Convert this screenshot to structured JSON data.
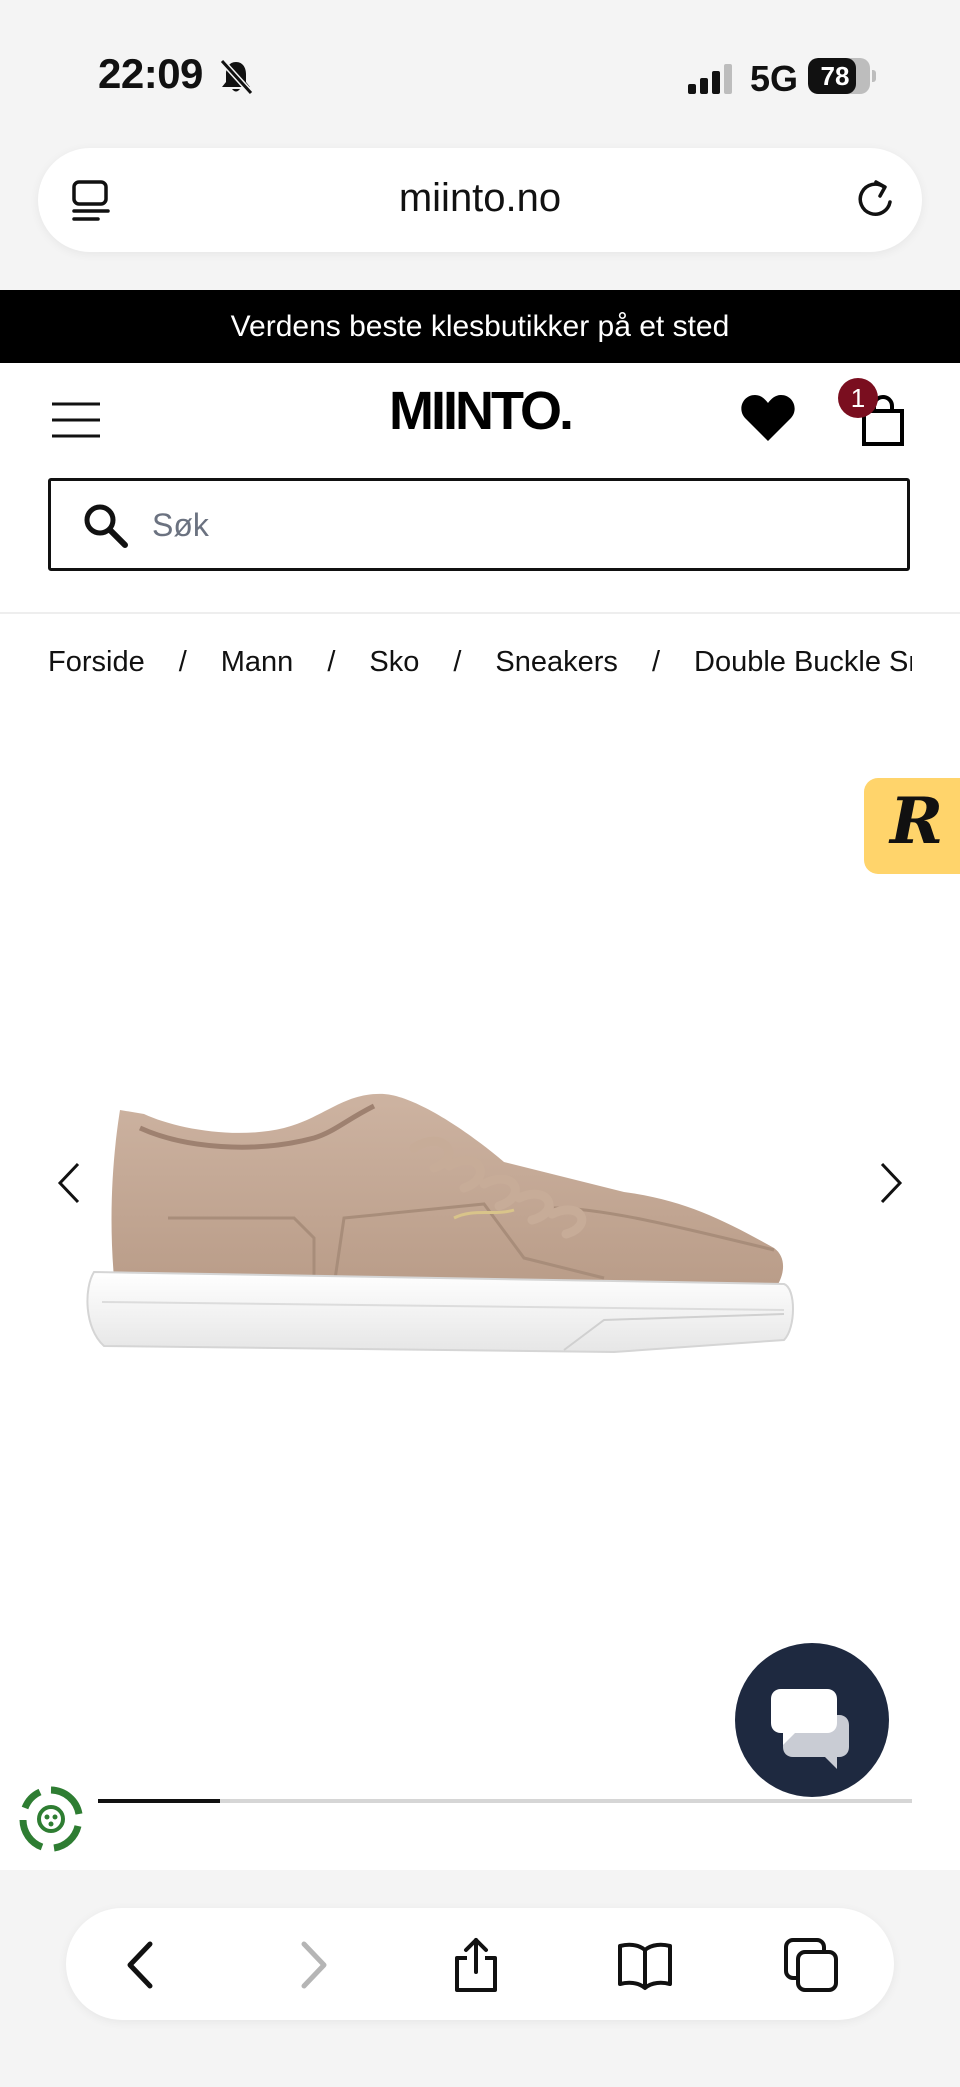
{
  "status_bar": {
    "time": "22:09",
    "network": "5G",
    "battery_level": "78",
    "battery_fraction": 0.78,
    "icons": [
      "bell-slash-icon",
      "signal-icon",
      "battery-icon"
    ]
  },
  "browser": {
    "url": "miinto.no",
    "icons": [
      "reader-icon",
      "reload-icon"
    ]
  },
  "promo": {
    "text": "Verdens beste klesbutikker på et sted"
  },
  "header": {
    "logo": "MIINTO.",
    "cart_count": "1",
    "icons": [
      "menu-icon",
      "heart-icon",
      "bag-icon"
    ]
  },
  "search": {
    "value": "",
    "placeholder": "Søk"
  },
  "breadcrumb": {
    "items": [
      "Forside",
      "Mann",
      "Sko",
      "Sneakers",
      "Double Buckle Sneakers"
    ],
    "separator": "/"
  },
  "gallery": {
    "review_widget_letter": "R",
    "slide_progress": 0.15,
    "product_image": "beige-leather-sneaker",
    "icons": [
      "chevron-left-icon",
      "chevron-right-icon",
      "chat-icon",
      "eco-icon"
    ]
  },
  "toolbar": {
    "icons": [
      "back-icon",
      "forward-icon",
      "share-icon",
      "bookmarks-icon",
      "tabs-icon"
    ]
  },
  "colors": {
    "banner_bg": "#000000",
    "badge": "#7a0e1f",
    "review_widget": "#ffd46b",
    "chat_button": "#1e2940",
    "eco_green": "#2e7d32"
  }
}
